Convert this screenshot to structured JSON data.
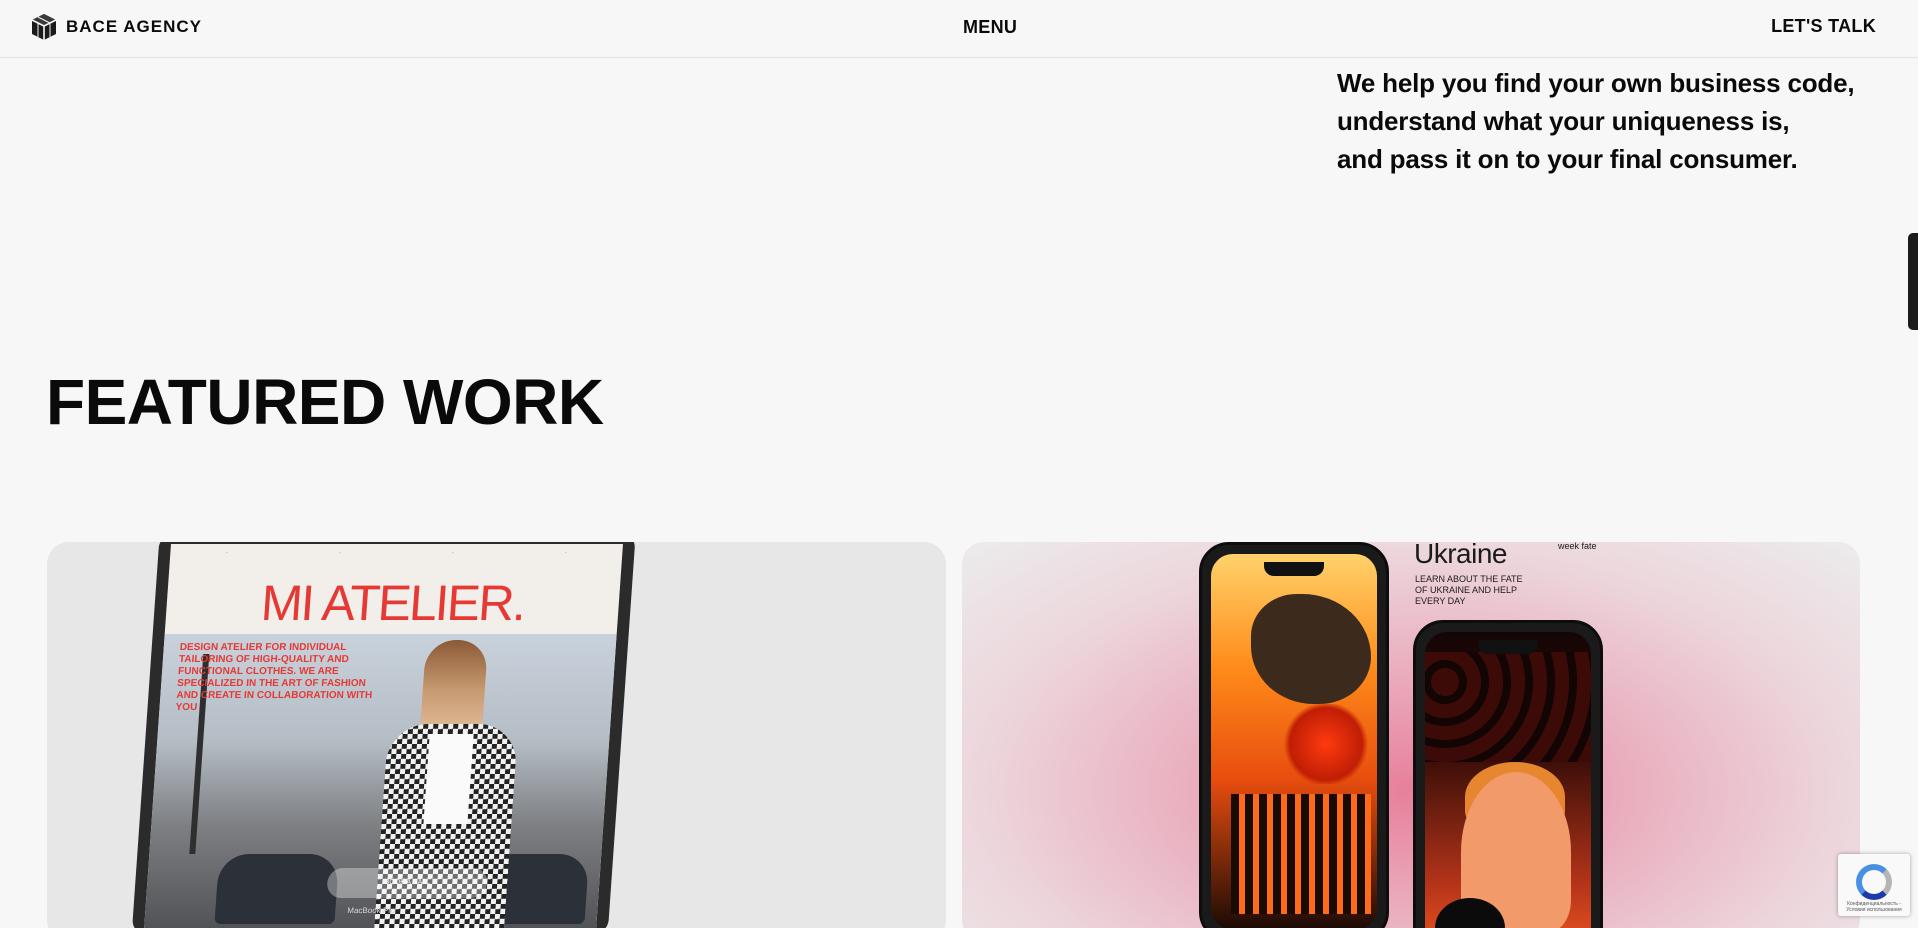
{
  "header": {
    "logo_text": "BACE AGENCY",
    "menu_label": "MENU",
    "talk_label": "LET'S TALK"
  },
  "intro": {
    "line1": "We help you find your own business code,",
    "line2": "understand what your uniqueness is,",
    "line3": "and pass it on to your final consumer."
  },
  "featured": {
    "title": "FEATURED WORK"
  },
  "works": [
    {
      "site_title": "MI ATELIER.",
      "site_text": "DESIGN ATELIER FOR INDIVIDUAL TAILORING OF HIGH-QUALITY AND FUNCTIONAL CLOTHES. WE ARE SPECIALIZED IN THE ART OF FASHION AND CREATE IN COLLABORATION WITH YOU",
      "book_button": "BOOK A CALL",
      "device_label": "MacBook Pro"
    },
    {
      "app_title": "Ukraine",
      "app_subtitle": "week fate",
      "app_text": "LEARN ABOUT THE FATE OF UKRAINE AND HELP EVERY DAY"
    }
  ],
  "recaptcha": {
    "text": "Конфиденциальность - Условия использования"
  },
  "colors": {
    "background": "#f7f7f7",
    "text": "#0a0a0a",
    "accent_red": "#e53935",
    "card_gray": "#e7e7e7",
    "card_pink": "#eab3c2"
  },
  "icons": {
    "logo": "bace-logo-icon",
    "recaptcha": "recaptcha-icon"
  }
}
